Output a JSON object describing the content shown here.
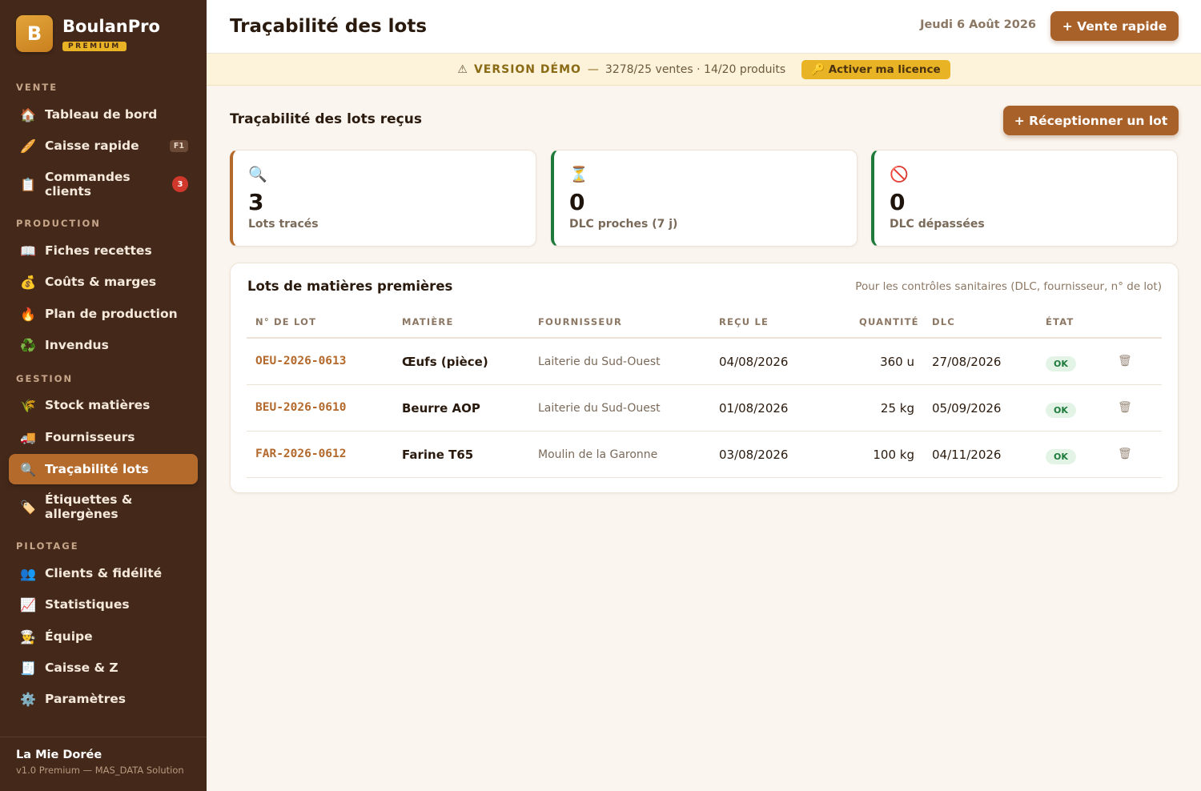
{
  "brand": {
    "logo_letter": "B",
    "name": "BoulanPro",
    "badge": "PREMIUM"
  },
  "sidebar": {
    "sections": [
      {
        "title": "VENTE"
      },
      {
        "title": "PRODUCTION"
      },
      {
        "title": "GESTION"
      },
      {
        "title": "PILOTAGE"
      }
    ],
    "items": [
      {
        "icon": "🏠",
        "label": "Tableau de bord"
      },
      {
        "icon": "🥖",
        "label": "Caisse rapide",
        "kbd": "F1"
      },
      {
        "icon": "📋",
        "label": "Commandes clients",
        "count": "3"
      },
      {
        "icon": "📖",
        "label": "Fiches recettes"
      },
      {
        "icon": "💰",
        "label": "Coûts & marges"
      },
      {
        "icon": "🔥",
        "label": "Plan de production"
      },
      {
        "icon": "♻️",
        "label": "Invendus"
      },
      {
        "icon": "🌾",
        "label": "Stock matières"
      },
      {
        "icon": "🚚",
        "label": "Fournisseurs"
      },
      {
        "icon": "🔍",
        "label": "Traçabilité lots",
        "active": true
      },
      {
        "icon": "🏷️",
        "label": "Étiquettes & allergènes"
      },
      {
        "icon": "👥",
        "label": "Clients & fidélité"
      },
      {
        "icon": "📈",
        "label": "Statistiques"
      },
      {
        "icon": "👨‍🍳",
        "label": "Équipe"
      },
      {
        "icon": "🧾",
        "label": "Caisse & Z"
      },
      {
        "icon": "⚙️",
        "label": "Paramètres"
      }
    ],
    "footer": {
      "shop": "La Mie Dorée",
      "version": "v1.0 Premium — MAS_DATA Solution"
    }
  },
  "header": {
    "title": "Traçabilité des lots",
    "date": "Jeudi 6 Août 2026",
    "quick_sale": "+ Vente rapide"
  },
  "banner": {
    "icon": "⚠",
    "label": "VERSION DÉMO",
    "dash": "—",
    "usage": "3278/25 ventes · 14/20 produits",
    "license_icon": "🔑",
    "license_button": "Activer ma licence"
  },
  "main": {
    "section_title": "Traçabilité des lots reçus",
    "receive_button": "+ Réceptionner un lot",
    "stats": [
      {
        "icon": "🔍",
        "value": "3",
        "label": "Lots tracés"
      },
      {
        "icon": "⏳",
        "value": "0",
        "label": "DLC proches (7 j)"
      },
      {
        "icon": "🚫",
        "value": "0",
        "label": "DLC dépassées"
      }
    ],
    "table": {
      "title": "Lots de matières premières",
      "hint": "Pour les contrôles sanitaires (DLC, fournisseur, n° de lot)",
      "columns": [
        "N° DE LOT",
        "MATIÈRE",
        "FOURNISSEUR",
        "REÇU LE",
        "QUANTITÉ",
        "DLC",
        "ÉTAT"
      ],
      "rows": [
        {
          "lot": "OEU-2026-0613",
          "matiere": "Œufs (pièce)",
          "fournisseur": "Laiterie du Sud-Ouest",
          "recu": "04/08/2026",
          "quantite": "360 u",
          "dlc": "27/08/2026",
          "etat": "OK"
        },
        {
          "lot": "BEU-2026-0610",
          "matiere": "Beurre AOP",
          "fournisseur": "Laiterie du Sud-Ouest",
          "recu": "01/08/2026",
          "quantite": "25 kg",
          "dlc": "05/09/2026",
          "etat": "OK"
        },
        {
          "lot": "FAR-2026-0612",
          "matiere": "Farine T65",
          "fournisseur": "Moulin de la Garonne",
          "recu": "03/08/2026",
          "quantite": "100 kg",
          "dlc": "04/11/2026",
          "etat": "OK"
        }
      ]
    }
  },
  "colors": {
    "sidebar": "#44291a",
    "accent": "#a9612a",
    "premium": "#e8b324",
    "ok": "#1e7a3b"
  }
}
